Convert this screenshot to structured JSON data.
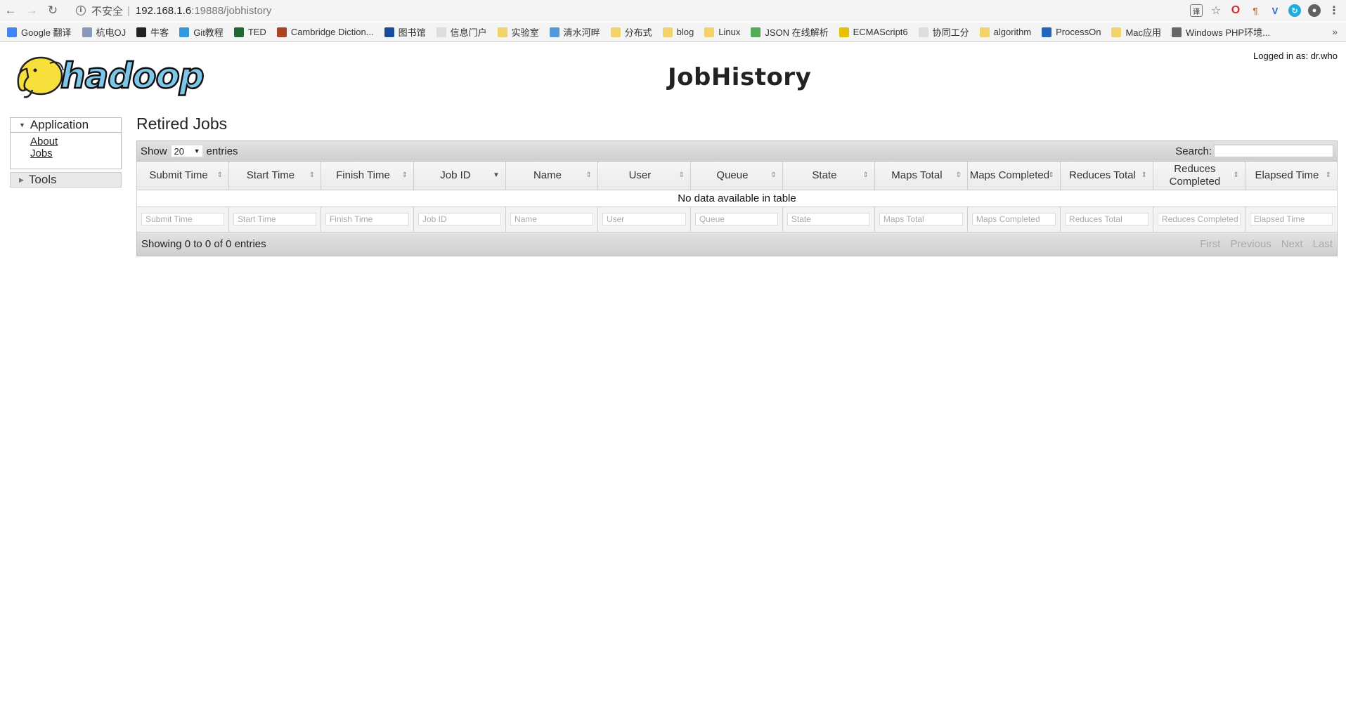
{
  "browser": {
    "insecure_label": "不安全",
    "url_host": "192.168.1.6",
    "url_rest": ":19888/jobhistory",
    "bookmarks": [
      {
        "label": "Google 翻译",
        "icon": "translate-icon",
        "color": "#4285f4"
      },
      {
        "label": "杭电OJ",
        "icon": "hdu-icon",
        "color": "#8899bb"
      },
      {
        "label": "牛客",
        "icon": "nowcoder-icon",
        "color": "#222222"
      },
      {
        "label": "Git教程",
        "icon": "git-icon",
        "color": "#3399dd"
      },
      {
        "label": "TED",
        "icon": "ted-icon",
        "color": "#226633"
      },
      {
        "label": "Cambridge Diction...",
        "icon": "cambridge-icon",
        "color": "#aa4422"
      },
      {
        "label": "图书馆",
        "icon": "library-icon",
        "color": "#1a4a9a"
      },
      {
        "label": "信息门户",
        "icon": "page-icon",
        "color": "#dddddd"
      },
      {
        "label": "实验室",
        "icon": "folder-icon",
        "color": "#f2d36b"
      },
      {
        "label": "清水河畔",
        "icon": "bbs-icon",
        "color": "#5599dd"
      },
      {
        "label": "分布式",
        "icon": "folder-icon",
        "color": "#f2d36b"
      },
      {
        "label": "blog",
        "icon": "folder-icon",
        "color": "#f2d36b"
      },
      {
        "label": "Linux",
        "icon": "folder-icon",
        "color": "#f2d36b"
      },
      {
        "label": "JSON 在线解析",
        "icon": "json-icon",
        "color": "#55aa55"
      },
      {
        "label": "ECMAScript6",
        "icon": "es-icon",
        "color": "#e6c300"
      },
      {
        "label": "协同工分",
        "icon": "page-icon",
        "color": "#dddddd"
      },
      {
        "label": "algorithm",
        "icon": "folder-icon",
        "color": "#f2d36b"
      },
      {
        "label": "ProcessOn",
        "icon": "processon-icon",
        "color": "#2266bb"
      },
      {
        "label": "Mac应用",
        "icon": "folder-icon",
        "color": "#f2d36b"
      },
      {
        "label": "Windows PHP环境...",
        "icon": "windows-php-icon",
        "color": "#666666"
      }
    ]
  },
  "header": {
    "logo_text": "hadoop",
    "title": "JobHistory",
    "logged_in": "Logged in as: dr.who"
  },
  "sidebar": {
    "application_label": "Application",
    "links": [
      "About",
      "Jobs"
    ],
    "tools_label": "Tools"
  },
  "main": {
    "section_title": "Retired Jobs",
    "show_label": "Show",
    "length_value": "20",
    "entries_label": "entries",
    "search_label": "Search:",
    "columns": [
      "Submit Time",
      "Start Time",
      "Finish Time",
      "Job ID",
      "Name",
      "User",
      "Queue",
      "State",
      "Maps Total",
      "Maps Completed",
      "Reduces Total",
      "Reduces Completed",
      "Elapsed Time"
    ],
    "empty_message": "No data available in table",
    "filter_placeholders": [
      "Submit Time",
      "Start Time",
      "Finish Time",
      "Job ID",
      "Name",
      "User",
      "Queue",
      "State",
      "Maps Total",
      "Maps Completed",
      "Reduces Total",
      "Reduces Completed",
      "Elapsed Time"
    ],
    "info": "Showing 0 to 0 of 0 entries",
    "pager": {
      "first": "First",
      "previous": "Previous",
      "next": "Next",
      "last": "Last"
    }
  }
}
